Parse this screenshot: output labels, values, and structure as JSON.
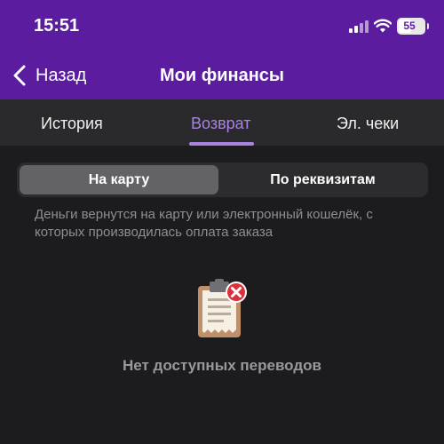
{
  "status": {
    "time": "15:51",
    "battery": "55"
  },
  "nav": {
    "back_label": "Назад",
    "title": "Мои финансы"
  },
  "tabs": [
    {
      "label": "История",
      "active": false
    },
    {
      "label": "Возврат",
      "active": true
    },
    {
      "label": "Эл. чеки",
      "active": false
    }
  ],
  "segment": {
    "options": [
      {
        "label": "На карту",
        "selected": true
      },
      {
        "label": "По реквизитам",
        "selected": false
      }
    ]
  },
  "info_text": "Деньги вернутся на карту или электронный кошелёк, с которых производилась оплата заказа",
  "empty_state": {
    "text": "Нет доступных переводов",
    "icon": "clipboard-error-icon"
  },
  "colors": {
    "header": "#5b1ca0",
    "accent": "#a982e0",
    "background": "#1c1c1e",
    "error": "#d9323c"
  }
}
